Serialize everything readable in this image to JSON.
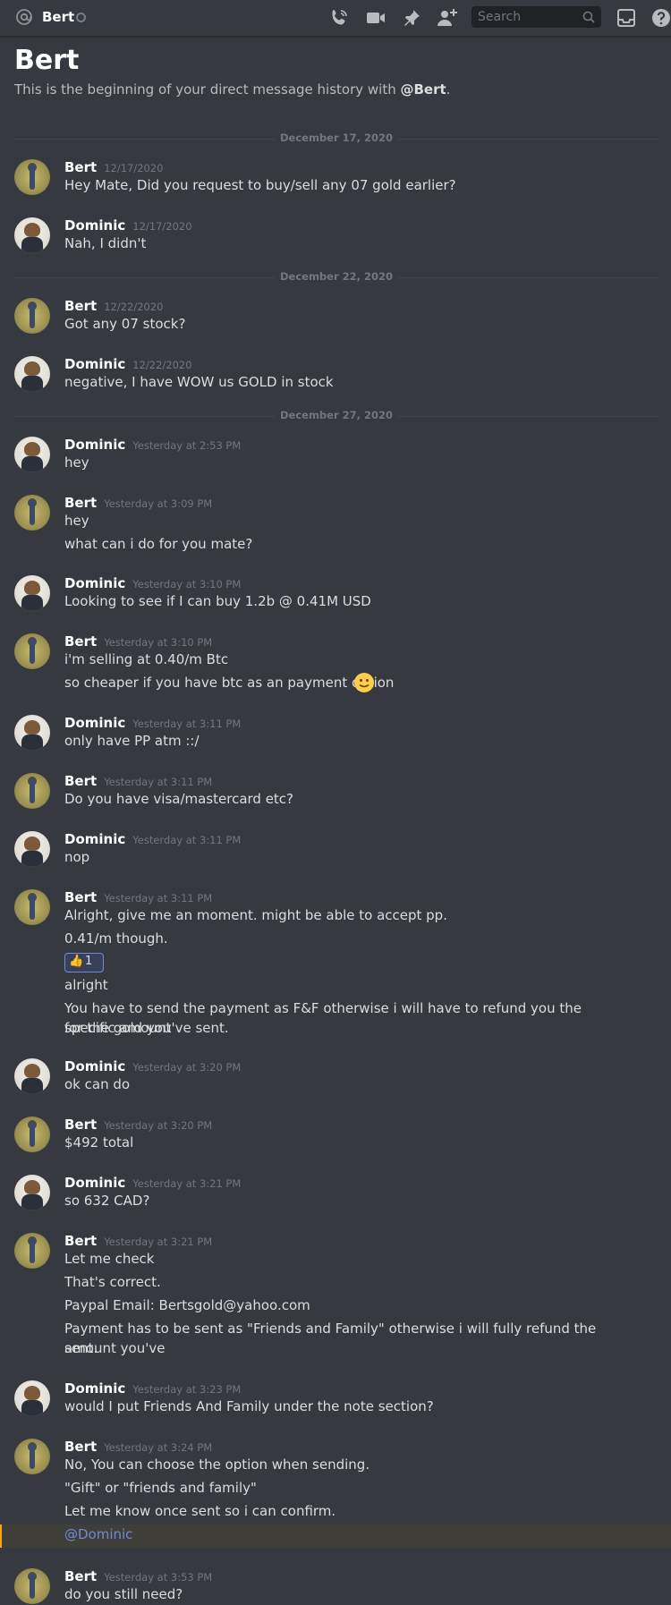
{
  "topbar": {
    "channel_name": "Bert",
    "search_placeholder": "Search",
    "icons": [
      "at-icon",
      "status-icon",
      "call-icon",
      "video-icon",
      "pin-icon",
      "add-friend-icon",
      "search-icon",
      "inbox-icon",
      "help-icon"
    ]
  },
  "header": {
    "title": "Bert",
    "intro_text": "This is the beginning of your direct message history with ",
    "intro_mention": "@Bert",
    "intro_end": "."
  },
  "dividers": [
    "December 17, 2020",
    "December 22, 2020",
    "December 27, 2020"
  ],
  "messages": [
    {
      "author": "Bert",
      "time": "12/17/2020",
      "lines": [
        "Hey Mate, Did you request to buy/sell any 07 gold earlier?"
      ]
    },
    {
      "author": "Dominic",
      "time": "12/17/2020",
      "lines": [
        "Nah, I didn't"
      ]
    },
    {
      "author": "Bert",
      "time": "12/22/2020",
      "lines": [
        "Got any 07 stock?"
      ]
    },
    {
      "author": "Dominic",
      "time": "12/22/2020",
      "lines": [
        "negative, I have WOW us GOLD in stock"
      ]
    },
    {
      "author": "Dominic",
      "time": "Yesterday at 2:53 PM",
      "lines": [
        "hey"
      ]
    },
    {
      "author": "Bert",
      "time": "Yesterday at 3:09 PM",
      "lines": [
        "hey",
        "what can i do for you mate?"
      ]
    },
    {
      "author": "Dominic",
      "time": "Yesterday at 3:10 PM",
      "lines": [
        "Looking to see if I can buy 1.2b @ 0.41M USD"
      ]
    },
    {
      "author": "Bert",
      "time": "Yesterday at 3:10 PM",
      "lines": [
        "i'm selling at 0.40/m Btc",
        "so cheaper if you have btc as an payment option"
      ]
    },
    {
      "author": "Dominic",
      "time": "Yesterday at 3:11 PM",
      "lines": [
        "only have PP atm ::/"
      ]
    },
    {
      "author": "Bert",
      "time": "Yesterday at 3:11 PM",
      "lines": [
        "Do you have visa/mastercard etc?"
      ]
    },
    {
      "author": "Dominic",
      "time": "Yesterday at 3:11 PM",
      "lines": [
        "nop"
      ]
    },
    {
      "author": "Bert",
      "time": "Yesterday at 3:11 PM",
      "lines": [
        "Alright, give me an moment. might be able to accept pp.",
        "0.41/m though.",
        "alright",
        "You have to send the payment as F&F otherwise i will have to refund you the specific amount",
        "for the gold you've sent."
      ],
      "reaction": {
        "emoji": "👍",
        "count": "1"
      }
    },
    {
      "author": "Dominic",
      "time": "Yesterday at 3:20 PM",
      "lines": [
        "ok can do"
      ]
    },
    {
      "author": "Bert",
      "time": "Yesterday at 3:20 PM",
      "lines": [
        "$492 total"
      ]
    },
    {
      "author": "Dominic",
      "time": "Yesterday at 3:21 PM",
      "lines": [
        "so 632 CAD?"
      ]
    },
    {
      "author": "Bert",
      "time": "Yesterday at 3:21 PM",
      "lines": [
        "Let me check",
        "That's correct.",
        "Paypal Email: Bertsgold@yahoo.com",
        "Payment has to be sent as \"Friends and Family\" otherwise i will fully refund the amount you've",
        "sent."
      ]
    },
    {
      "author": "Dominic",
      "time": "Yesterday at 3:23 PM",
      "lines": [
        "would I put Friends And Family under the note section?"
      ]
    },
    {
      "author": "Bert",
      "time": "Yesterday at 3:24 PM",
      "lines": [
        "No, You can choose the option when sending.",
        "\"Gift\" or \"friends and family\"",
        "Let me know once sent so i can confirm."
      ],
      "mention": "@Dominic"
    },
    {
      "author": "Bert",
      "time": "Yesterday at 3:53 PM",
      "lines": [
        "do you still need?"
      ]
    }
  ]
}
